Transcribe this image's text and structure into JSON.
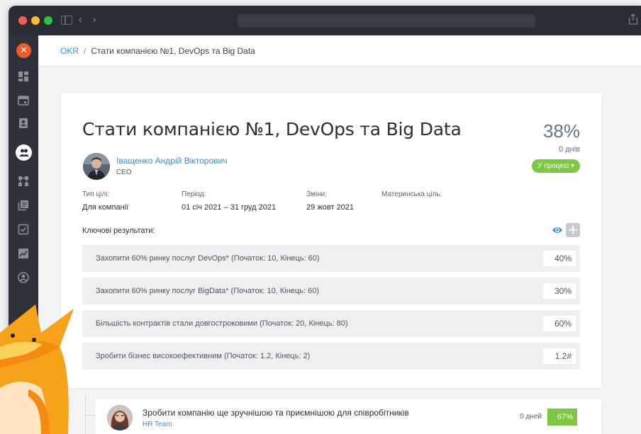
{
  "breadcrumbs": {
    "root": "OKR",
    "separator": "/",
    "current": "Стати компанією №1, DevOps та Big Data"
  },
  "goal": {
    "title": "Стати компанією №1, DevOps та Big Data",
    "percent": "38%",
    "days": "0 днів",
    "status": "У процесі ▾",
    "owner": {
      "name": "Іващенко Андрій Вікторович",
      "role": "CEO"
    },
    "meta": {
      "type_label": "Тип цілі:",
      "type_value": "Для компанії",
      "period_label": "Період:",
      "period_value": "01 січ 2021 – 31 груд 2021",
      "changes_label": "Зміни:",
      "changes_value": "29 жовт 2021",
      "parent_label": "Материнська ціль:"
    },
    "key_results_heading": "Ключові результати:",
    "key_results": [
      {
        "text": "Захопити 60% ринку послуг DevOps* (Початок: 10, Кінець: 60)",
        "value": "40%"
      },
      {
        "text": "Захопити 60% ринку послуг BigData* (Початок: 10, Кінець: 60)",
        "value": "30%"
      },
      {
        "text": "Більшість контрактів стали довгостроковими (Початок: 20, Кінець: 80)",
        "value": "60%"
      },
      {
        "text": "Зробити бізнес високоефективним  (Початок: 1.2, Кінець: 2)",
        "value": "1.2#"
      }
    ]
  },
  "child_goal": {
    "title": "Зробити компанію ще зручнішою та приємнішою для співробітників",
    "team": "HR Team",
    "days": "0 дней",
    "percent": "67%"
  },
  "colors": {
    "accent_blue": "#3c8ed6",
    "status_green": "#7cc843",
    "logo_orange": "#f15a24",
    "sidebar_dark": "#2f323a"
  }
}
